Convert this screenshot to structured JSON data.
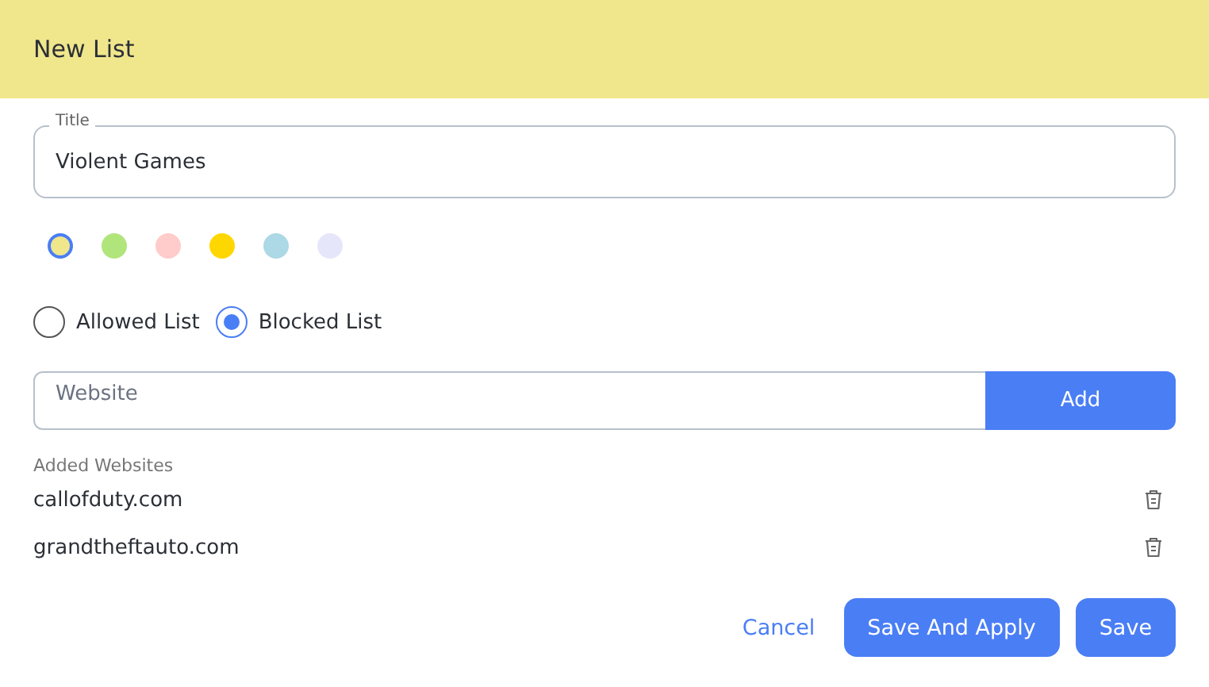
{
  "header": {
    "title": "New List"
  },
  "title_field": {
    "label": "Title",
    "value": "Violent Games"
  },
  "colors": [
    {
      "color": "#f0e68c",
      "selected": true
    },
    {
      "color": "#b0e57c",
      "selected": false
    },
    {
      "color": "#ffcccb",
      "selected": false
    },
    {
      "color": "#ffd700",
      "selected": false
    },
    {
      "color": "#add8e6",
      "selected": false
    },
    {
      "color": "#e6e6fa",
      "selected": false
    }
  ],
  "list_types": [
    {
      "label": "Allowed List",
      "selected": false
    },
    {
      "label": "Blocked List",
      "selected": true
    }
  ],
  "website_field": {
    "placeholder": "Website",
    "button": "Add"
  },
  "added_websites": {
    "heading": "Added Websites",
    "items": [
      "callofduty.com",
      "grandtheftauto.com"
    ]
  },
  "buttons": [
    {
      "label": "Cancel",
      "kind": "link"
    },
    {
      "label": "Save And Apply",
      "kind": "primary"
    },
    {
      "label": "Save",
      "kind": "primary"
    }
  ]
}
